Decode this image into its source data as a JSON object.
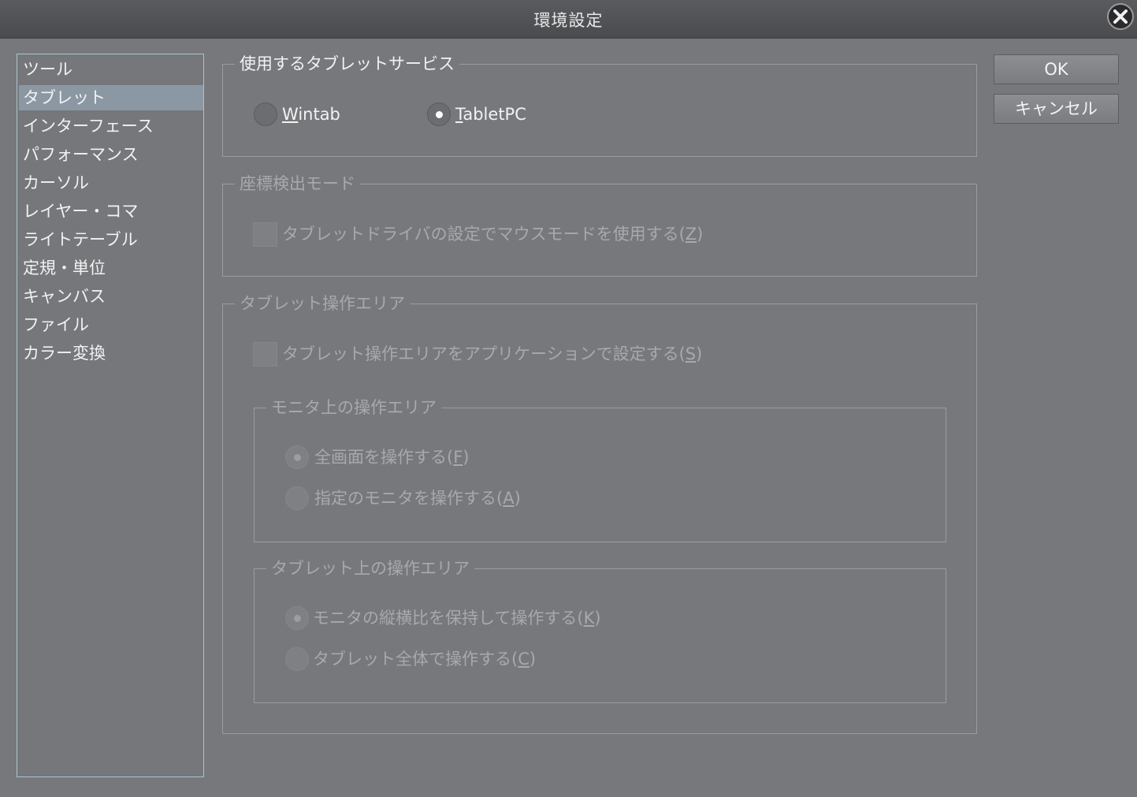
{
  "window": {
    "title": "環境設定"
  },
  "sidebar": {
    "items": [
      {
        "label": "ツール"
      },
      {
        "label": "タブレット"
      },
      {
        "label": "インターフェース"
      },
      {
        "label": "パフォーマンス"
      },
      {
        "label": "カーソル"
      },
      {
        "label": "レイヤー・コマ"
      },
      {
        "label": "ライトテーブル"
      },
      {
        "label": "定規・単位"
      },
      {
        "label": "キャンバス"
      },
      {
        "label": "ファイル"
      },
      {
        "label": "カラー変換"
      }
    ],
    "selected": "タブレット"
  },
  "tablet_service": {
    "title": "使用するタブレットサービス",
    "wintab": {
      "key": "W",
      "rest": "intab",
      "checked": false
    },
    "tabletpc": {
      "key": "T",
      "rest": "abletPC",
      "checked": true
    }
  },
  "coord_mode": {
    "title": "座標検出モード",
    "mouse_mode": {
      "label": "タブレットドライバの設定でマウスモードを使用する(",
      "key": "Z",
      "suffix": ")",
      "checked": false
    }
  },
  "tablet_area": {
    "title": "タブレット操作エリア",
    "app_setting": {
      "label": "タブレット操作エリアをアプリケーションで設定する(",
      "key": "S",
      "suffix": ")",
      "checked": false
    },
    "monitor_group": {
      "title": "モニタ上の操作エリア",
      "full_screen": {
        "label": "全画面を操作する(",
        "key": "F",
        "suffix": ")",
        "checked": true
      },
      "specified_monitor": {
        "label": "指定のモニタを操作する(",
        "key": "A",
        "suffix": ")",
        "checked": false
      }
    },
    "tablet_group": {
      "title": "タブレット上の操作エリア",
      "keep_ratio": {
        "label": "モニタの縦横比を保持して操作する(",
        "key": "K",
        "suffix": ")",
        "checked": true
      },
      "whole_tablet": {
        "label": "タブレット全体で操作する(",
        "key": "C",
        "suffix": ")",
        "checked": false
      }
    }
  },
  "buttons": {
    "ok": "OK",
    "cancel": "キャンセル"
  },
  "icons": {
    "close": "close-icon"
  },
  "colors": {
    "background": "#77787c",
    "selection": "#8b98a3",
    "titlebar": "#4e4f53"
  }
}
